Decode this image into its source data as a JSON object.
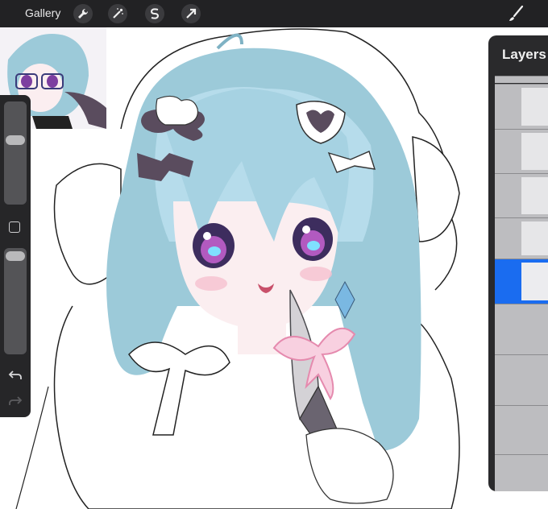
{
  "topbar": {
    "gallery_label": "Gallery",
    "tools": [
      {
        "name": "actions-wrench-icon"
      },
      {
        "name": "adjustments-wand-icon"
      },
      {
        "name": "selection-icon"
      },
      {
        "name": "transform-arrow-icon"
      }
    ],
    "brush_icon": "brush-icon"
  },
  "sidebar": {
    "brush_size_level": 0.2,
    "opacity_level": 0.05,
    "modify_button": "square-icon",
    "undo_icon": "undo-icon",
    "redo_icon": "redo-icon"
  },
  "layers_panel": {
    "title": "Layers",
    "selected_row_color": "#1a6cf0"
  },
  "colors": {
    "toolbar_bg": "#222224",
    "panel_bg": "#2a2a2c",
    "hair": "#9ccad9",
    "ribbon_pink": "#f4a8c8",
    "bow_dark": "#5a4c5e"
  }
}
